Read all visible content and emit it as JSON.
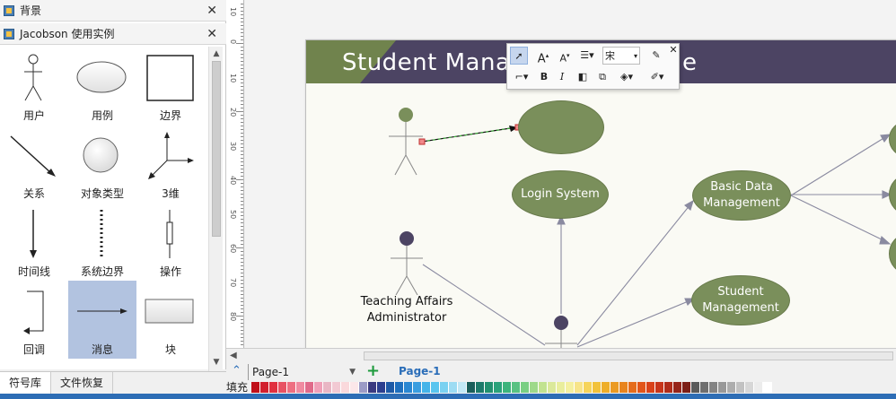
{
  "left_panel": {
    "header1": {
      "title": "背景"
    },
    "header2": {
      "title": "Jacobson 使用实例"
    },
    "shapes": [
      {
        "label": "用户",
        "icon": "actor-icon"
      },
      {
        "label": "用例",
        "icon": "ellipse-icon"
      },
      {
        "label": "边界",
        "icon": "rectangle-icon"
      },
      {
        "label": "关系",
        "icon": "arrow-icon"
      },
      {
        "label": "对象类型",
        "icon": "circle-icon"
      },
      {
        "label": "3维",
        "icon": "axes-icon"
      },
      {
        "label": "时间线",
        "icon": "timeline-icon"
      },
      {
        "label": "系统边界",
        "icon": "dashed-line-icon"
      },
      {
        "label": "操作",
        "icon": "operation-icon"
      },
      {
        "label": "回调",
        "icon": "callback-icon"
      },
      {
        "label": "消息",
        "icon": "message-icon"
      },
      {
        "label": "块",
        "icon": "block-icon"
      }
    ],
    "selected_shape": "消息",
    "bottom_tabs": [
      "符号库",
      "文件恢复"
    ]
  },
  "ruler": {
    "marks": [
      "10",
      "0",
      "10",
      "20",
      "30",
      "40",
      "50",
      "60",
      "70",
      "80"
    ]
  },
  "diagram": {
    "title": "Student Management System Use Case",
    "title_visible": "Student Manag",
    "title_tail": "e",
    "use_cases": [
      {
        "label": ""
      },
      {
        "label": "Login System"
      },
      {
        "label": "Basic Data Management"
      },
      {
        "label": "Student Management"
      }
    ],
    "actor_label": "Teaching Affairs Administrator"
  },
  "float_toolbar": {
    "font_name": "宋"
  },
  "page_bar": {
    "page_select": "Page-1",
    "active_page": "Page-1"
  },
  "palette": {
    "fill_label": "填充",
    "colors": [
      "#c0101a",
      "#d2202e",
      "#e0303f",
      "#e85263",
      "#ee6f81",
      "#f08aa0",
      "#e06a8a",
      "#f0a0b8",
      "#e9b6c4",
      "#f2c9d3",
      "#fad9dc",
      "#fbe7e9",
      "#9b9bc6",
      "#3a3a80",
      "#2c3f8f",
      "#1e5aa6",
      "#1e6fbe",
      "#2a87d2",
      "#3a9ee0",
      "#45b4e9",
      "#59c5ef",
      "#7ad1f1",
      "#9ddcf3",
      "#c2e8f5",
      "#1a5e5a",
      "#1d7a6a",
      "#22906f",
      "#2aa27a",
      "#3cb47c",
      "#58c282",
      "#79cf83",
      "#9ed98a",
      "#c2e390",
      "#dbe99a",
      "#e9ee9d",
      "#f4f0a0",
      "#f7e489",
      "#f6d45a",
      "#f2c23a",
      "#eeae2a",
      "#eb9a23",
      "#e8841e",
      "#e56c1c",
      "#e2551a",
      "#d9421a",
      "#c7351b",
      "#b02c1a",
      "#962419",
      "#7c1e16",
      "#5a5a5a",
      "#6e6e6e",
      "#838383",
      "#989898",
      "#adadad",
      "#c2c2c2",
      "#d7d7d7",
      "#ececec",
      "#ffffff"
    ]
  }
}
